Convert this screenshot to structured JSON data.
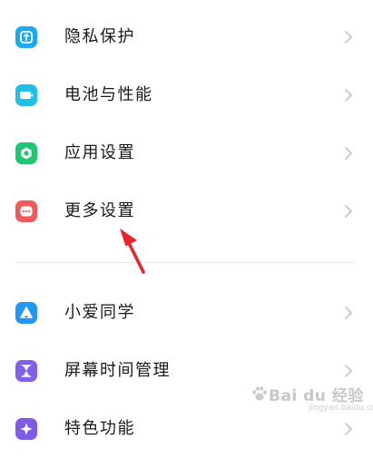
{
  "settings": {
    "items": [
      {
        "label": "隐私保护",
        "icon": "privacy-shield-icon",
        "color": "#1eaaf1"
      },
      {
        "label": "电池与性能",
        "icon": "battery-icon",
        "color": "#20bfe6"
      },
      {
        "label": "应用设置",
        "icon": "app-settings-icon",
        "color": "#1fc773"
      },
      {
        "label": "更多设置",
        "icon": "more-icon",
        "color": "#f05a5a"
      },
      {
        "label": "小爱同学",
        "icon": "assistant-icon",
        "color": "#2196f3"
      },
      {
        "label": "屏幕时间管理",
        "icon": "hourglass-icon",
        "color": "#8060e8"
      },
      {
        "label": "特色功能",
        "icon": "feature-icon",
        "color": "#7e5ce6"
      }
    ]
  },
  "watermark": {
    "brand": "Bai du 经验",
    "sub": "jingyan.baidu.com"
  }
}
